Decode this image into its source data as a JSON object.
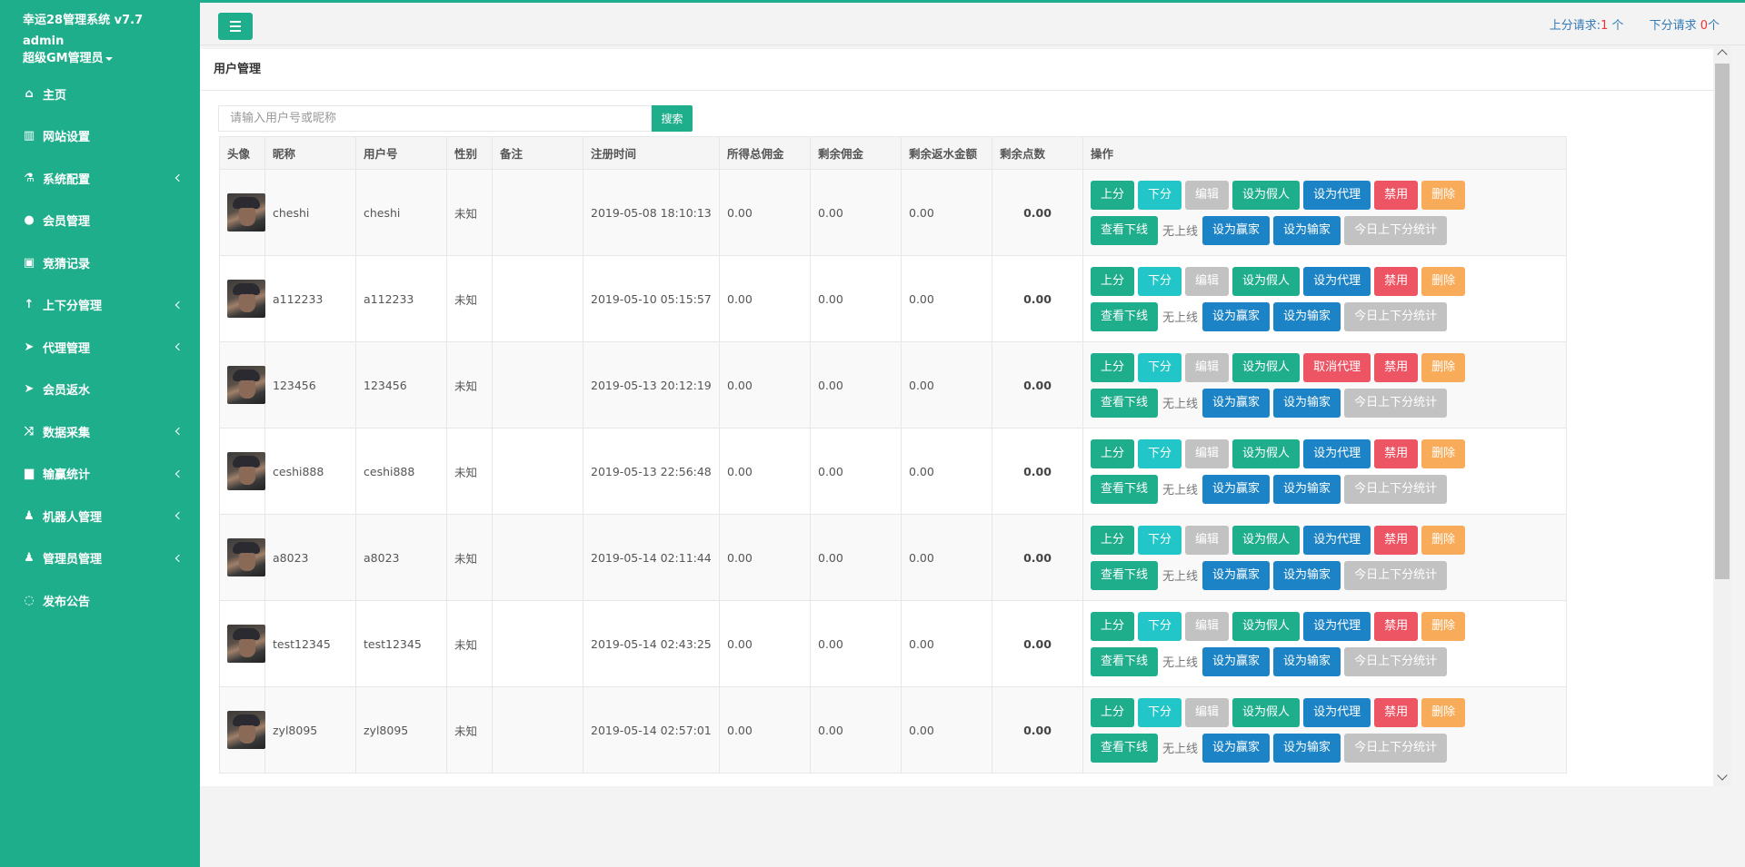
{
  "app": {
    "title": "幸运28管理系统 v7.7",
    "user": "admin",
    "role": "超级GM管理员"
  },
  "sidebar": {
    "items": [
      {
        "label": "主页",
        "icon": "home-icon",
        "has_arrow": false
      },
      {
        "label": "网站设置",
        "icon": "columns-icon",
        "has_arrow": false
      },
      {
        "label": "系统配置",
        "icon": "flask-icon",
        "has_arrow": true
      },
      {
        "label": "会员管理",
        "icon": "user-icon",
        "has_arrow": false
      },
      {
        "label": "竞猜记录",
        "icon": "car-icon",
        "has_arrow": false
      },
      {
        "label": "上下分管理",
        "icon": "level-up-icon",
        "has_arrow": true
      },
      {
        "label": "代理管理",
        "icon": "paper-plane-icon",
        "has_arrow": true
      },
      {
        "label": "会员返水",
        "icon": "paper-plane-icon",
        "has_arrow": false
      },
      {
        "label": "数据采集",
        "icon": "random-icon",
        "has_arrow": true
      },
      {
        "label": "输赢统计",
        "icon": "bar-chart-icon",
        "has_arrow": true
      },
      {
        "label": "机器人管理",
        "icon": "male-icon",
        "has_arrow": true
      },
      {
        "label": "管理员管理",
        "icon": "male-icon",
        "has_arrow": true
      },
      {
        "label": "发布公告",
        "icon": "comments-icon",
        "has_arrow": false
      }
    ]
  },
  "topbar": {
    "up_request_label": "上分请求:",
    "up_request_count": "1",
    "up_request_unit": " 个",
    "down_request_label": "下分请求 ",
    "down_request_count": "0",
    "down_request_unit": "个"
  },
  "page": {
    "title": "用户管理",
    "search_placeholder": "请输入用户号或昵称",
    "search_button": "搜索"
  },
  "table": {
    "headers": [
      "头像",
      "昵称",
      "用户号",
      "性别",
      "备注",
      "注册时间",
      "所得总佣金",
      "剩余佣金",
      "剩余返水金额",
      "剩余点数",
      "操作"
    ],
    "rows": [
      {
        "nickname": "cheshi",
        "userid": "cheshi",
        "gender": "未知",
        "note": "",
        "reg_time": "2019-05-08 18:10:13",
        "total_commission": "0.00",
        "remain_commission": "0.00",
        "remain_rebate": "0.00",
        "points": "0.00",
        "agent_action": "设为代理"
      },
      {
        "nickname": "a112233",
        "userid": "a112233",
        "gender": "未知",
        "note": "",
        "reg_time": "2019-05-10 05:15:57",
        "total_commission": "0.00",
        "remain_commission": "0.00",
        "remain_rebate": "0.00",
        "points": "0.00",
        "agent_action": "设为代理"
      },
      {
        "nickname": "123456",
        "userid": "123456",
        "gender": "未知",
        "note": "",
        "reg_time": "2019-05-13 20:12:19",
        "total_commission": "0.00",
        "remain_commission": "0.00",
        "remain_rebate": "0.00",
        "points": "0.00",
        "agent_action": "取消代理"
      },
      {
        "nickname": "ceshi888",
        "userid": "ceshi888",
        "gender": "未知",
        "note": "",
        "reg_time": "2019-05-13 22:56:48",
        "total_commission": "0.00",
        "remain_commission": "0.00",
        "remain_rebate": "0.00",
        "points": "0.00",
        "agent_action": "设为代理"
      },
      {
        "nickname": "a8023",
        "userid": "a8023",
        "gender": "未知",
        "note": "",
        "reg_time": "2019-05-14 02:11:44",
        "total_commission": "0.00",
        "remain_commission": "0.00",
        "remain_rebate": "0.00",
        "points": "0.00",
        "agent_action": "设为代理"
      },
      {
        "nickname": "test12345",
        "userid": "test12345",
        "gender": "未知",
        "note": "",
        "reg_time": "2019-05-14 02:43:25",
        "total_commission": "0.00",
        "remain_commission": "0.00",
        "remain_rebate": "0.00",
        "points": "0.00",
        "agent_action": "设为代理"
      },
      {
        "nickname": "zyl8095",
        "userid": "zyl8095",
        "gender": "未知",
        "note": "",
        "reg_time": "2019-05-14 02:57:01",
        "total_commission": "0.00",
        "remain_commission": "0.00",
        "remain_rebate": "0.00",
        "points": "0.00",
        "agent_action": "设为代理"
      }
    ],
    "actions": {
      "up": "上分",
      "down": "下分",
      "edit": "编辑",
      "set_fake": "设为假人",
      "ban": "禁用",
      "delete": "删除",
      "view_downline": "查看下线",
      "no_upline": "无上线",
      "set_winner": "设为赢家",
      "set_loser": "设为输家",
      "today_stats": "今日上下分统计"
    }
  },
  "colors": {
    "primary": "#1fae8c",
    "cyan": "#23c6c8",
    "blue": "#1c84c6",
    "red": "#ed5565",
    "orange": "#f8ac59",
    "gray": "#c2c2c2"
  }
}
